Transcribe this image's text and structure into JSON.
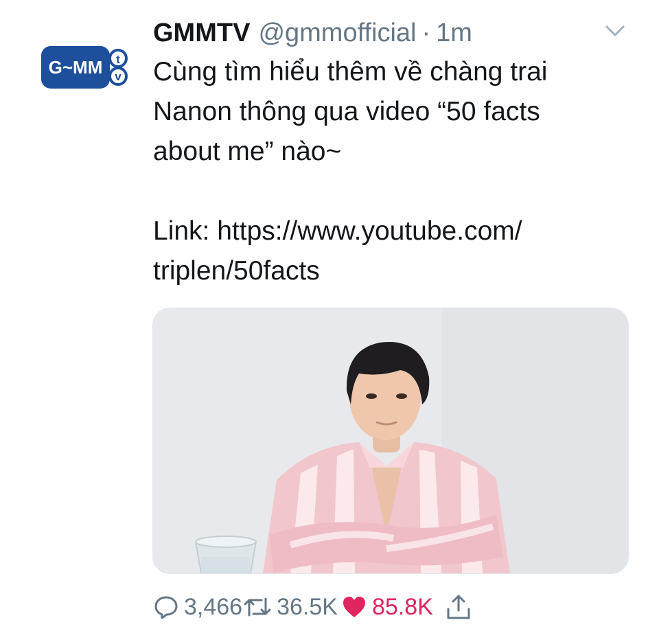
{
  "tweet": {
    "display_name": "GMMTV",
    "handle": "@gmmofficial",
    "separator": "·",
    "time": "1m",
    "avatar": {
      "logo_text": "G~MM",
      "badge_text_1": "t",
      "badge_text_2": "v",
      "logo_color": "#1d4f9c"
    },
    "text_lines": [
      "Cùng tìm hiểu thêm về chàng trai",
      "Nanon thông qua video “50 facts",
      "about me” nào~",
      "",
      "Link: https://www.youtube.com/",
      "triplen/50facts"
    ],
    "media": {
      "type": "photo"
    }
  },
  "actions": {
    "reply": {
      "icon": "reply-icon",
      "count": "3,466"
    },
    "retweet": {
      "icon": "retweet-icon",
      "count": "36.5K"
    },
    "like": {
      "icon": "heart-filled-icon",
      "count": "85.8K",
      "color": "#e0245e"
    },
    "share": {
      "icon": "share-icon"
    }
  },
  "colors": {
    "text": "#14171a",
    "secondary": "#657786",
    "like": "#e0245e"
  }
}
